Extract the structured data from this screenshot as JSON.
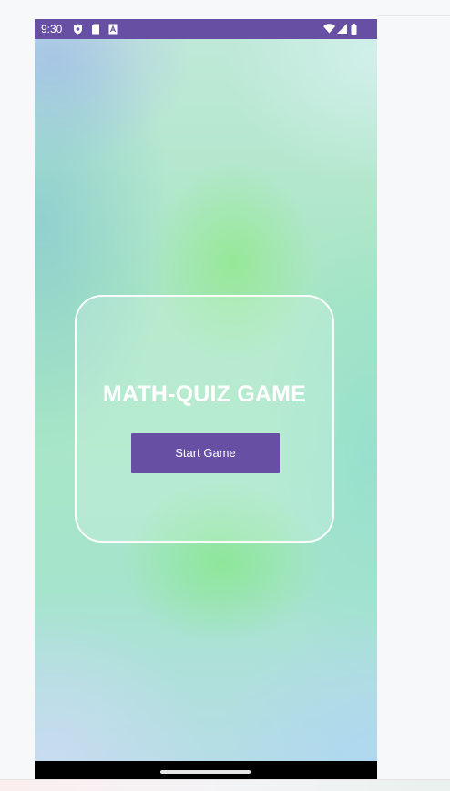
{
  "status_bar": {
    "time": "9:30",
    "left_icons": [
      "shield-icon",
      "sd-card-icon",
      "font-a-icon"
    ],
    "right_icons": [
      "wifi-icon",
      "signal-icon",
      "battery-icon"
    ],
    "color": "#6750a4"
  },
  "screen": {
    "title": "MATH-QUIZ GAME",
    "start_button_label": "Start Game",
    "accent_color": "#6750a4"
  },
  "navigation_bar": {
    "handle": "home-handle"
  }
}
